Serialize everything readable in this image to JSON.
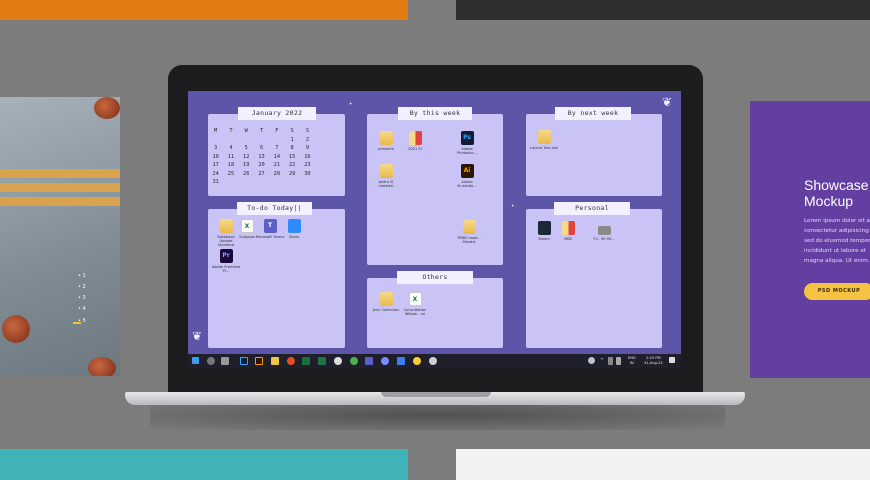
{
  "desktop": {
    "panels": {
      "calendar_title": "January 2022",
      "this_week_title": "By this week",
      "next_week_title": "By next week",
      "todo_title": "To-do Today||",
      "others_title": "Others",
      "personal_title": "Personal"
    },
    "calendar": {
      "weekdays": [
        "M",
        "T",
        "W",
        "T",
        "F",
        "S",
        "S"
      ],
      "weeks": [
        [
          "",
          "",
          "",
          "",
          "",
          "1",
          "2"
        ],
        [
          "3",
          "4",
          "5",
          "6",
          "7",
          "8",
          "9"
        ],
        [
          "10",
          "11",
          "12",
          "13",
          "14",
          "15",
          "16"
        ],
        [
          "17",
          "18",
          "19",
          "20",
          "21",
          "22",
          "23"
        ],
        [
          "24",
          "25",
          "26",
          "27",
          "28",
          "29",
          "30"
        ],
        [
          "31",
          "",
          "",
          "",
          "",
          "",
          ""
        ]
      ]
    },
    "icons": {
      "this_week": [
        {
          "label": "presente",
          "kind": "folder"
        },
        {
          "label": "2021 EI",
          "kind": "mix"
        },
        {
          "label": "Adobe Photosho...",
          "kind": "ps"
        },
        {
          "label": "pedro IS material",
          "kind": "folder"
        },
        {
          "label": "Adobe Illustrato...",
          "kind": "ai"
        },
        {
          "label": "TMBS noad... Mandal",
          "kind": "folder"
        }
      ],
      "next_week": [
        {
          "label": "Lalena Tres alai",
          "kind": "folder"
        }
      ],
      "todo": [
        {
          "label": "Database Update Standard",
          "kind": "folder"
        },
        {
          "label": "Sunpose",
          "kind": "xl"
        },
        {
          "label": "Microsoft Teams",
          "kind": "teams"
        },
        {
          "label": "Zoom",
          "kind": "zoom"
        },
        {
          "label": "Adobe Premiere Pr...",
          "kind": "pr"
        }
      ],
      "others": [
        {
          "label": "Jenn Collection",
          "kind": "folder"
        },
        {
          "label": "Consultation Wkbok - ml",
          "kind": "xl"
        }
      ],
      "personal": [
        {
          "label": "Steam",
          "kind": "steam"
        },
        {
          "label": "MBS",
          "kind": "mix"
        },
        {
          "label": "F.C. 90 90...",
          "kind": "drive"
        }
      ]
    },
    "taskbar": {
      "lang": "ENG",
      "region": "IN",
      "time": "2:25 PM",
      "date": "31-Aug-22"
    }
  },
  "right_card": {
    "title": "Showcase\nMockup",
    "body": "Lorem ipsum dolor sit am\nconsectetur adipisicing el\nsed do eiusmod tempor\nincididunt ut labore et\nmagna aliqua. Ut enim.",
    "button": "PSD MOCKUP"
  },
  "left_card": {
    "nav_items": [
      "1",
      "2",
      "3",
      "4",
      "5"
    ]
  },
  "colors": {
    "wallpaper": "#5c55a8",
    "panel": "#c9c3f6",
    "card_purple": "#623fa1",
    "button_yellow": "#f5c242"
  }
}
